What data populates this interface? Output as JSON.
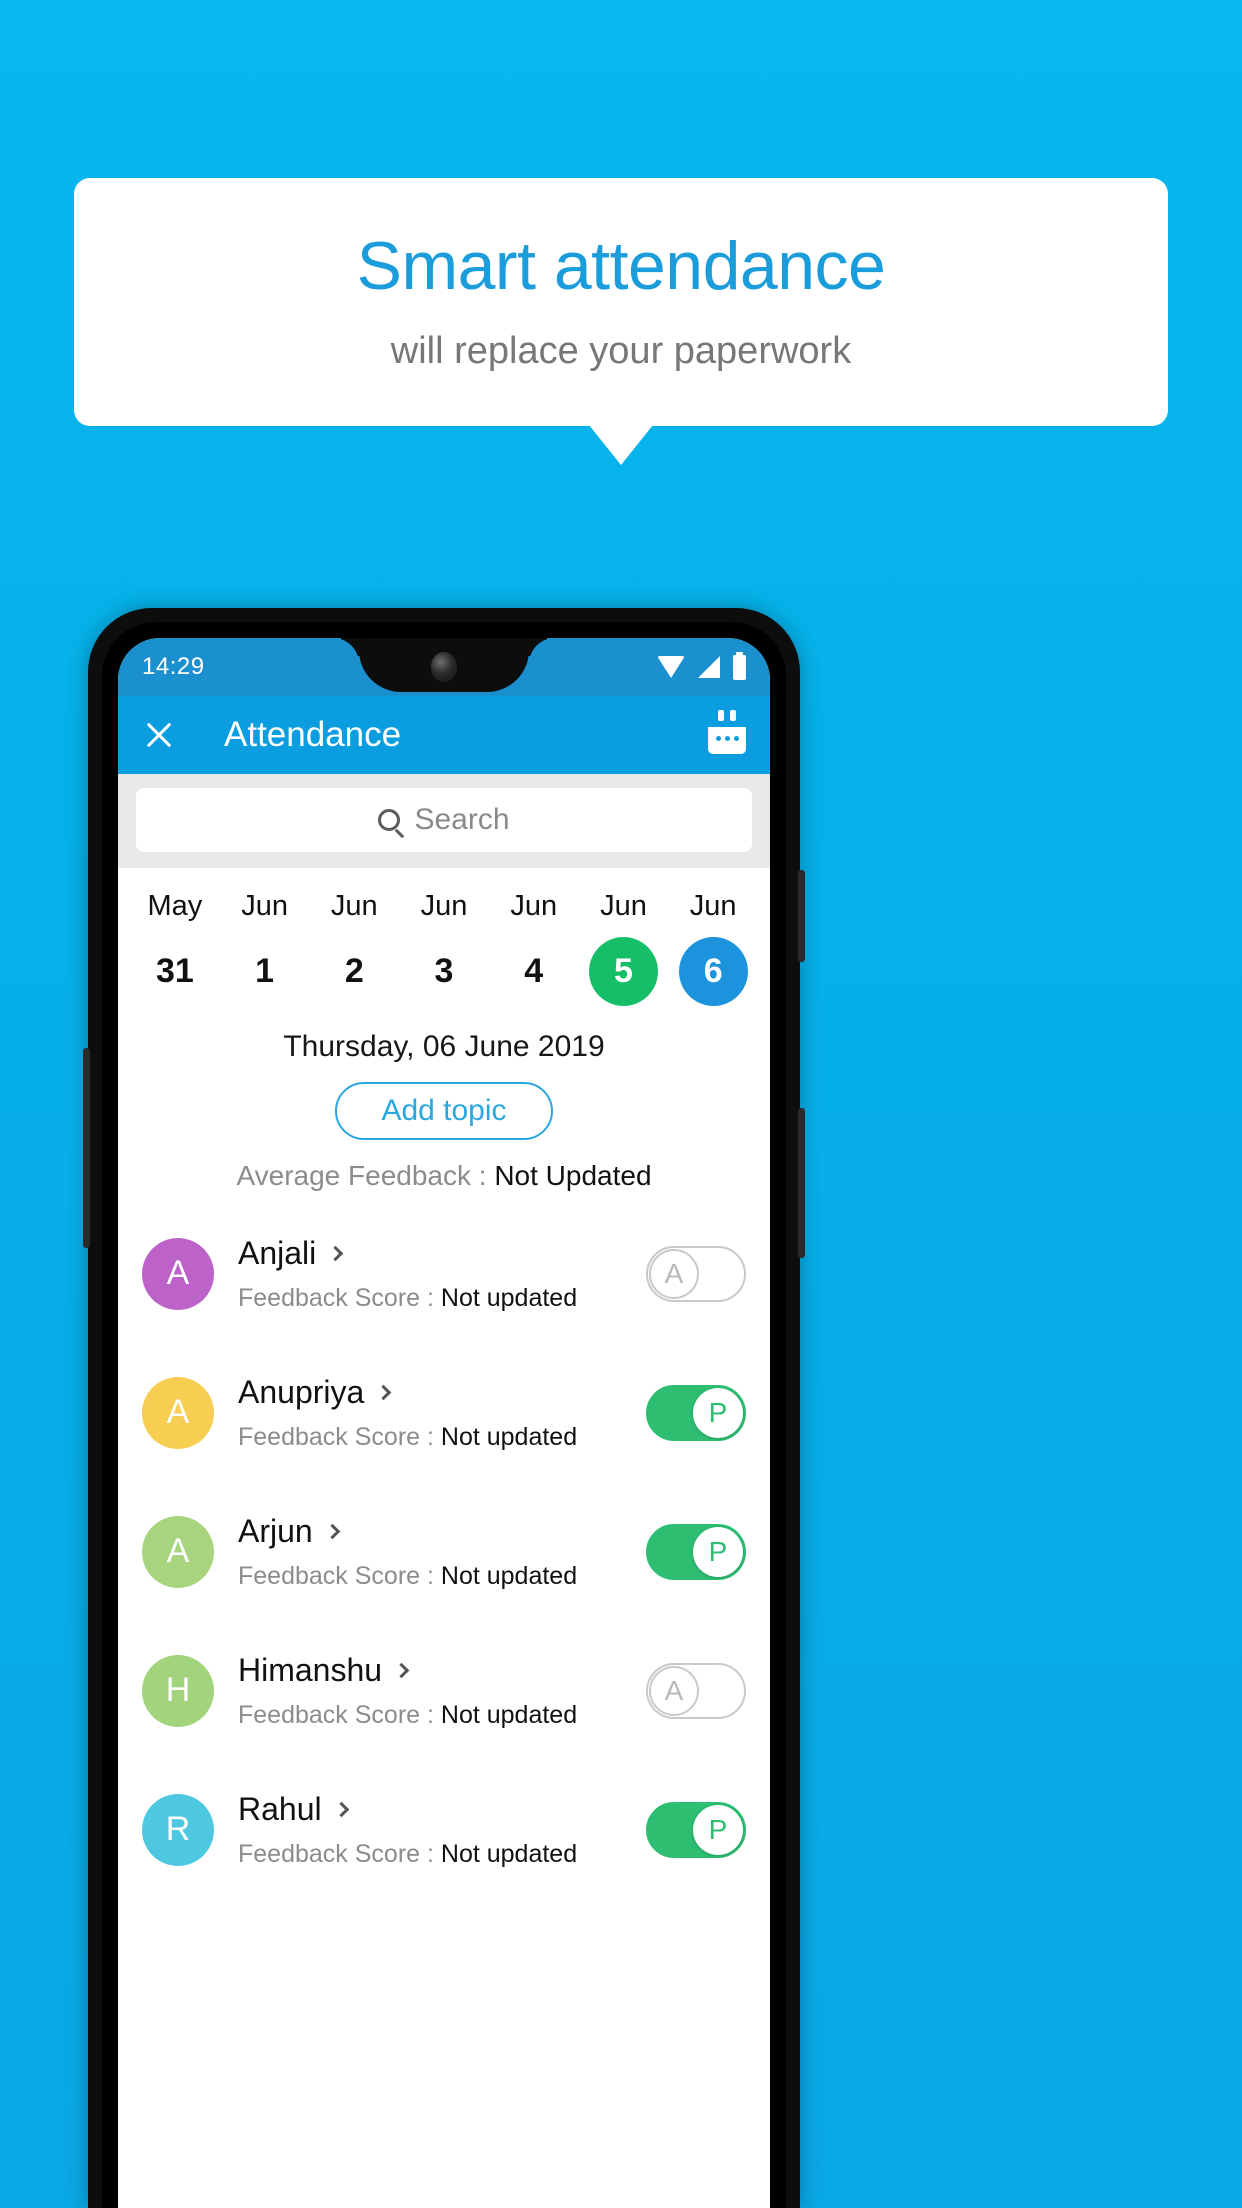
{
  "promo": {
    "title": "Smart attendance",
    "subtitle": "will replace your paperwork",
    "accent_color": "#1b9ddb",
    "background_color": "#06b0e8"
  },
  "phone": {
    "statusbar": {
      "time": "14:29",
      "icons": [
        "wifi-icon",
        "signal-icon",
        "battery-icon"
      ],
      "background_color": "#1b90cf"
    },
    "appbar": {
      "close_icon": "close-icon",
      "title": "Attendance",
      "action_icon": "calendar-icon",
      "background_color": "#0a9ddf"
    },
    "search": {
      "placeholder": "Search",
      "icon": "search-icon"
    },
    "date_strip": [
      {
        "month": "May",
        "day": "31",
        "state": "normal"
      },
      {
        "month": "Jun",
        "day": "1",
        "state": "normal"
      },
      {
        "month": "Jun",
        "day": "2",
        "state": "normal"
      },
      {
        "month": "Jun",
        "day": "3",
        "state": "normal"
      },
      {
        "month": "Jun",
        "day": "4",
        "state": "normal"
      },
      {
        "month": "Jun",
        "day": "5",
        "state": "today",
        "color": "#14bf67"
      },
      {
        "month": "Jun",
        "day": "6",
        "state": "selected",
        "color": "#1e93dd"
      }
    ],
    "selected_date_label": "Thursday, 06 June 2019",
    "add_topic_label": "Add topic",
    "average_feedback": {
      "label": "Average Feedback : ",
      "value": "Not Updated"
    },
    "feedback_score_label": "Feedback Score : ",
    "students": [
      {
        "name": "Anjali",
        "initial": "A",
        "avatar_color": "#bd62c9",
        "feedback_score": "Not updated",
        "attendance": "A",
        "attendance_state": "absent"
      },
      {
        "name": "Anupriya",
        "initial": "A",
        "avatar_color": "#f7cd52",
        "feedback_score": "Not updated",
        "attendance": "P",
        "attendance_state": "present"
      },
      {
        "name": "Arjun",
        "initial": "A",
        "avatar_color": "#a8d47f",
        "feedback_score": "Not updated",
        "attendance": "P",
        "attendance_state": "present"
      },
      {
        "name": "Himanshu",
        "initial": "H",
        "avatar_color": "#a1d47c",
        "feedback_score": "Not updated",
        "attendance": "A",
        "attendance_state": "absent"
      },
      {
        "name": "Rahul",
        "initial": "R",
        "avatar_color": "#4ec8e0",
        "feedback_score": "Not updated",
        "attendance": "P",
        "attendance_state": "present"
      }
    ]
  }
}
